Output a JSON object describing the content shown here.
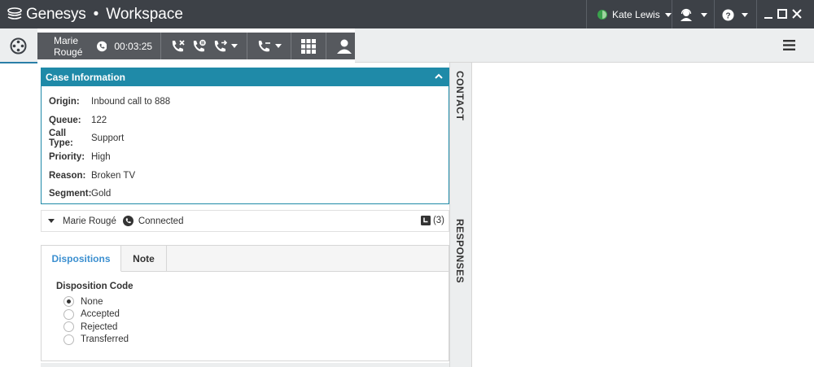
{
  "titlebar": {
    "brand_name": "Genesys",
    "brand_dot": "•",
    "app_name": "Workspace",
    "user_name": "Kate Lewis",
    "status_color": "#3aa24c"
  },
  "interaction": {
    "party_name": "Marie Rougé",
    "timer": "00:03:25",
    "icons": [
      "phone-icon",
      "end-call-icon",
      "hold-call-icon",
      "transfer-call-icon",
      "conference-call-icon",
      "keypad-icon",
      "add-party-icon"
    ]
  },
  "case_info": {
    "header": "Case Information",
    "rows": [
      {
        "label": "Origin:",
        "value": "Inbound call to 888"
      },
      {
        "label": "Queue:",
        "value": "122"
      },
      {
        "label": "Call Type:",
        "value": "Support"
      },
      {
        "label": "Priority:",
        "value": "High"
      },
      {
        "label": "Reason:",
        "value": "Broken TV"
      },
      {
        "label": "Segment:",
        "value": "Gold"
      }
    ]
  },
  "side_tabs": {
    "contact": "CONTACT",
    "responses": "RESPONSES"
  },
  "party": {
    "name": "Marie Rougé",
    "status": "Connected",
    "count": "(3)"
  },
  "dispositions": {
    "tabs": [
      "Dispositions",
      "Note"
    ],
    "title": "Disposition Code",
    "options": [
      {
        "label": "None",
        "checked": true
      },
      {
        "label": "Accepted",
        "checked": false
      },
      {
        "label": "Rejected",
        "checked": false
      },
      {
        "label": "Transferred",
        "checked": false
      }
    ]
  },
  "colors": {
    "titlebar": "#3d4147",
    "accent": "#1f8aa8",
    "tab_active": "#3b8fd0",
    "interaction_bar": "#56595e"
  }
}
